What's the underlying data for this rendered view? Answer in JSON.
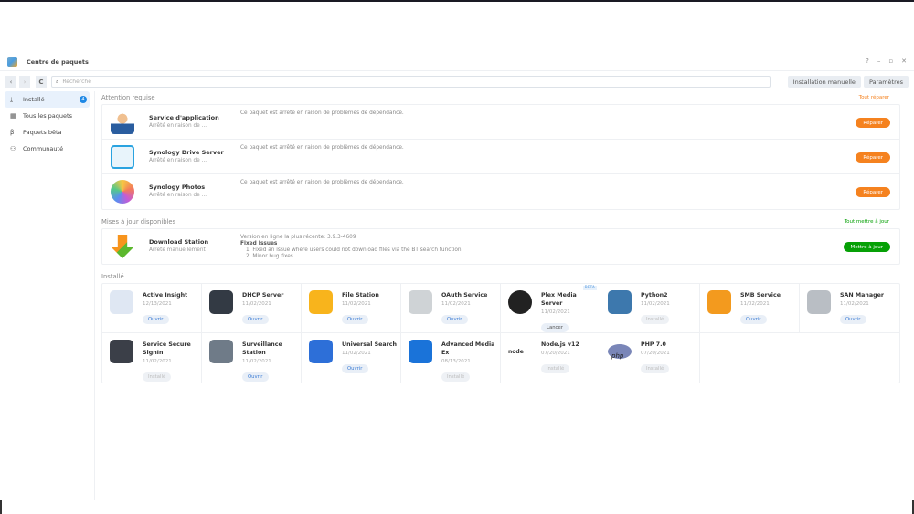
{
  "window": {
    "title": "Centre de paquets",
    "help": "?",
    "minimize": "–",
    "restore": "▫",
    "close": "✕"
  },
  "toolbar": {
    "back": "‹",
    "forward": "›",
    "refresh": "C",
    "search_placeholder": "Recherche",
    "manual_install": "Installation manuelle",
    "settings": "Paramètres"
  },
  "sidebar": {
    "items": [
      {
        "label": "Installé",
        "icon": "download-icon",
        "badge": "4"
      },
      {
        "label": "Tous les paquets",
        "icon": "grid-icon"
      },
      {
        "label": "Paquets bêta",
        "icon": "beta-icon"
      },
      {
        "label": "Communauté",
        "icon": "community-icon"
      }
    ]
  },
  "attention": {
    "title": "Attention requise",
    "action": "Tout réparer",
    "items": [
      {
        "name": "Service d'application",
        "status": "Arrêté en raison de ...",
        "desc": "Ce paquet est arrêté en raison de problèmes de dépendance.",
        "button": "Réparer",
        "color": "#2a5d9f"
      },
      {
        "name": "Synology Drive Server",
        "status": "Arrêté en raison de ...",
        "desc": "Ce paquet est arrêté en raison de problèmes de dépendance.",
        "button": "Réparer",
        "color": "#2aa3e0"
      },
      {
        "name": "Synology Photos",
        "status": "Arrêté en raison de ...",
        "desc": "Ce paquet est arrêté en raison de problèmes de dépendance.",
        "button": "Réparer",
        "color": "#f37a5a"
      }
    ]
  },
  "updates": {
    "title": "Mises à jour disponibles",
    "action": "Tout mettre à jour",
    "items": [
      {
        "name": "Download Station",
        "status": "Arrêté manuellement",
        "version": "Version en ligne la plus récente: 3.9.3-4609",
        "fixed_title": "Fixed Issues",
        "fixes": [
          "1. Fixed an issue where users could not download files via the BT search function.",
          "2. Minor bug fixes."
        ],
        "button": "Mettre à jour"
      }
    ]
  },
  "installed": {
    "title": "Installé",
    "items": [
      {
        "name": "Active Insight",
        "date": "12/13/2021",
        "button": "Ouvrir",
        "kind": "open",
        "color": "#dfe7f3"
      },
      {
        "name": "DHCP Server",
        "date": "11/02/2021",
        "button": "Ouvrir",
        "kind": "open",
        "color": "#333a44"
      },
      {
        "name": "File Station",
        "date": "11/02/2021",
        "button": "Ouvrir",
        "kind": "open",
        "color": "#f8b41c"
      },
      {
        "name": "OAuth Service",
        "date": "11/02/2021",
        "button": "Ouvrir",
        "kind": "open",
        "color": "#cfd3d6"
      },
      {
        "name": "Plex Media Server",
        "date": "11/02/2021",
        "button": "Lancer",
        "kind": "launch",
        "color": "#222",
        "beta": "BETA"
      },
      {
        "name": "Python2",
        "date": "11/02/2021",
        "button": "Installé",
        "kind": "inst",
        "color": "#3d78ad"
      },
      {
        "name": "SMB Service",
        "date": "11/02/2021",
        "button": "Ouvrir",
        "kind": "open",
        "color": "#f39a1e"
      },
      {
        "name": "SAN Manager",
        "date": "11/02/2021",
        "button": "Ouvrir",
        "kind": "open",
        "color": "#b9bec4"
      },
      {
        "name": "Service Secure SignIn",
        "date": "11/02/2021",
        "button": "Installé",
        "kind": "inst",
        "color": "#3b3f48"
      },
      {
        "name": "Surveillance Station",
        "date": "11/02/2021",
        "button": "Ouvrir",
        "kind": "open",
        "color": "#6f7b88"
      },
      {
        "name": "Universal Search",
        "date": "11/02/2021",
        "button": "Ouvrir",
        "kind": "open",
        "color": "#2d6fd8"
      },
      {
        "name": "Advanced Media Ex",
        "date": "08/13/2021",
        "button": "Installé",
        "kind": "inst",
        "color": "#1a73d9"
      },
      {
        "name": "Node.js v12",
        "date": "07/20/2021",
        "button": "Installé",
        "kind": "inst",
        "color": "#ffffff",
        "logo": "node"
      },
      {
        "name": "PHP 7.0",
        "date": "07/20/2021",
        "button": "Installé",
        "kind": "inst",
        "color": "#7a86b8",
        "logo": "php"
      }
    ]
  }
}
